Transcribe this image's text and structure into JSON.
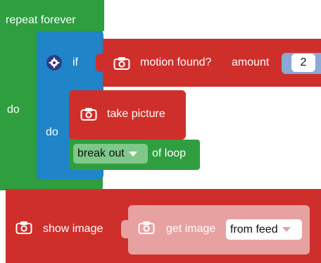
{
  "workspace": {
    "background": "#ffffff"
  },
  "blocks": {
    "repeat": {
      "label": "repeat forever",
      "do_label": "do",
      "color": "#2e9e3f"
    },
    "if_block": {
      "icon": "gear-icon",
      "label": "if",
      "do_label": "do",
      "color": "#1f84c8"
    },
    "motion": {
      "icon": "camera-icon",
      "label": "motion found?",
      "amount_label": "amount",
      "amount_value": "2",
      "color": "#cf2f2a"
    },
    "take_picture": {
      "icon": "camera-icon",
      "label": "take picture",
      "color": "#cf2f2a"
    },
    "break_loop": {
      "dropdown_value": "break out",
      "suffix": "of loop",
      "color": "#2e9e3f"
    },
    "show_image": {
      "icon": "camera-icon",
      "label": "show image",
      "color": "#cf2f2a"
    },
    "get_image": {
      "icon": "camera-icon",
      "label": "get image",
      "dropdown_value": "from feed",
      "color": "#e8a1a1"
    }
  }
}
